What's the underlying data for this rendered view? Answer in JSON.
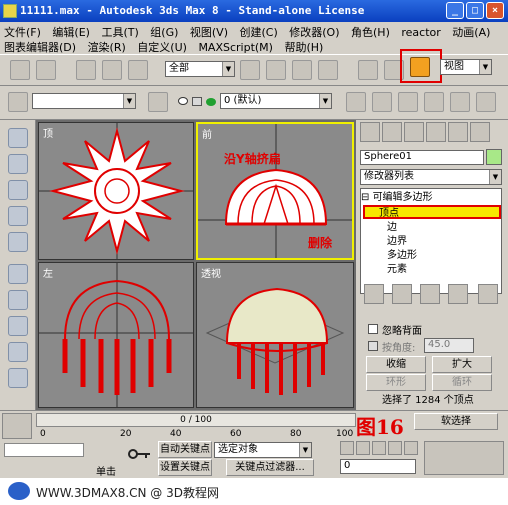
{
  "titlebar": {
    "title": "11111.max - Autodesk 3ds Max 8  - Stand-alone License",
    "minimize": "_",
    "maximize": "□",
    "close": "×"
  },
  "menu": {
    "row1": [
      "文件(F)",
      "编辑(E)",
      "工具(T)",
      "组(G)",
      "视图(V)",
      "创建(C)",
      "修改器(O)",
      "角色(H)",
      "reactor",
      "动画(A)"
    ],
    "row2": [
      "图表编辑器(D)",
      "渲染(R)",
      "自定义(U)",
      "MAXScript(M)",
      "帮助(H)"
    ]
  },
  "toolbar1": {
    "selection_filter": "全部",
    "coord_dropdown": "视图"
  },
  "toolbar2": {
    "layer": "0 (默认)"
  },
  "viewports": {
    "top": "顶",
    "front": "前",
    "left": "左",
    "perspective": "透视"
  },
  "annotations": {
    "scale_along_y": "沿Y轴挤扁",
    "delete": "删除",
    "figure": "图16"
  },
  "command_panel": {
    "object_name": "Sphere01",
    "modifier_list": "修改器列表",
    "stack": [
      "可编辑多边形",
      "顶点",
      "边",
      "边界",
      "多边形",
      "元素"
    ],
    "ignore_backfacing": "忽略背面",
    "by_angle": "按角度:",
    "angle_value": "45.0",
    "shrink": "收缩",
    "grow": "扩大",
    "ring": "环形",
    "loop": "循环",
    "selection_status": "选择了 1284 个顶点",
    "soft_selection": "软选择"
  },
  "bottom": {
    "frame_counter": "0 / 100",
    "ruler_ticks": [
      "0",
      "20",
      "40",
      "60",
      "80",
      "100"
    ],
    "auto_key": "自动关键点",
    "selected_object": "选定对象",
    "set_key": "设置关键点",
    "key_filters": "关键点过滤器...",
    "click_prompt": "单击",
    "frame_field": "0"
  },
  "footer": {
    "site": "WWW.3DMAX8.CN @ 3D教程网"
  }
}
